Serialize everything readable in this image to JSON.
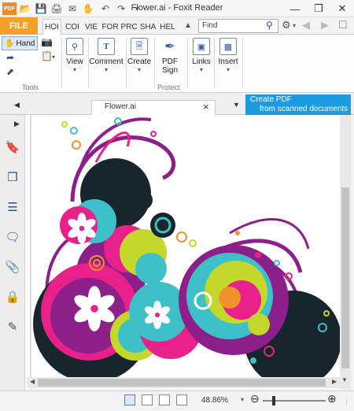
{
  "window": {
    "title": "Flower.ai - Foxit Reader",
    "minimize": "—",
    "restore": "❒",
    "close": "✕"
  },
  "quick_access": [
    "PDF",
    "open-icon",
    "save-icon",
    "print-icon",
    "email-icon",
    "hand-icon",
    "undo-icon",
    "redo-icon",
    "customize-icon"
  ],
  "ribbon_tabs": {
    "file": "FILE",
    "tabs": [
      "HOI",
      "COI",
      "VIE",
      "FOR",
      "PRC",
      "SHA",
      "HEL"
    ]
  },
  "search": {
    "placeholder": "Find"
  },
  "ribbon": {
    "hand_label": "Hand",
    "view_label": "View",
    "comment_label": "Comment",
    "create_label": "Create",
    "pdf_sign_label": "PDF\nSign",
    "links_label": "Links",
    "insert_label": "Insert",
    "group_tools": "Tools",
    "group_protect": "Protect"
  },
  "tabs": {
    "doc_title": "Flower.ai",
    "close": "×",
    "ad_line1": "Create PDF",
    "ad_line2": "from scanned documents"
  },
  "status": {
    "zoom": "48.86%"
  },
  "colors": {
    "file_tab": "#f5a02a",
    "ad_bg": "#1d9be0",
    "accent": "#3c5fa1",
    "magenta": "#e8208a",
    "purple": "#8d1f8a",
    "teal": "#3ec0c8",
    "lime": "#c3d82a",
    "dark": "#16262c",
    "orange": "#f0922a"
  }
}
